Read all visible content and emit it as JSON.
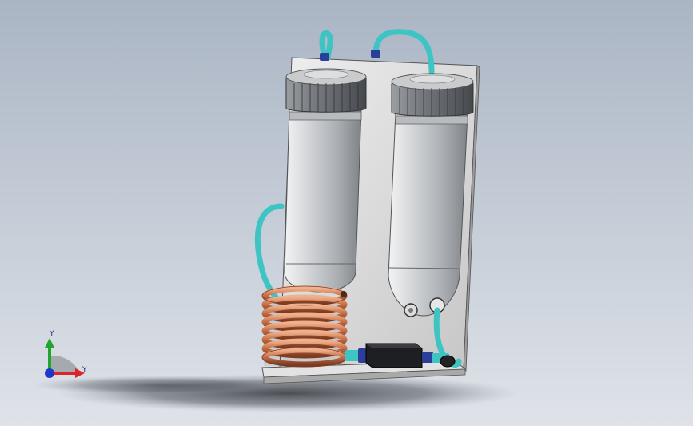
{
  "axis_triad": {
    "y_label": "Y",
    "x_label": "Y",
    "colors": {
      "y_axis": "#22a52e",
      "x_axis": "#d8262a",
      "z_axis": "#1f38c8"
    }
  },
  "model": {
    "components": [
      "back-plate",
      "base-plate",
      "filter-housing-left",
      "filter-housing-right",
      "copper-coil",
      "pump-unit",
      "tubing"
    ],
    "colors": {
      "tubing": "#3fc4c4",
      "copper": "#c9744d",
      "housing": "#c8cbcf",
      "cap": "#6e7277",
      "plate": "#dcdcdc",
      "fitting": "#2b3f9a"
    }
  }
}
